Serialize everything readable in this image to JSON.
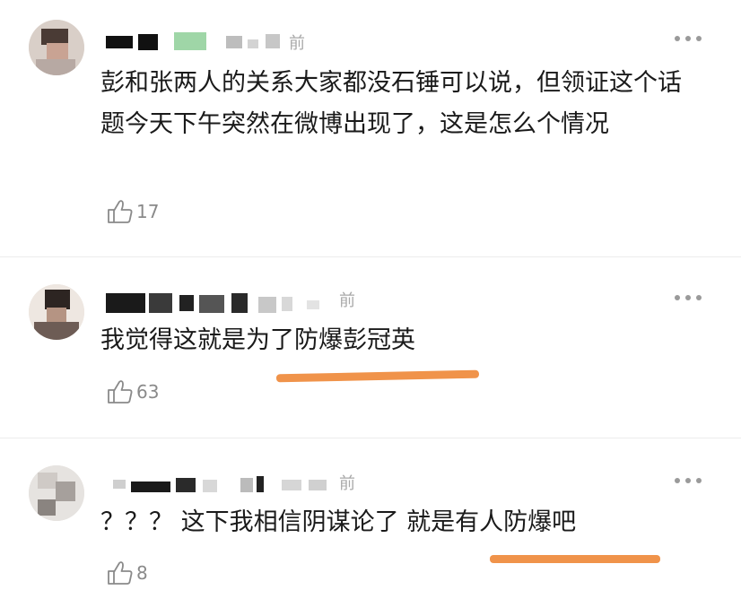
{
  "colors": {
    "accent_underline": "#f0934a",
    "text": "#1a1a1a",
    "muted": "#a8a8a8"
  },
  "comments": [
    {
      "time_suffix": "前",
      "text": "彭和张两人的关系大家都没石锤可以说，但领证这个话题今天下午突然在微博出现了，这是怎么个情况",
      "likes": "17",
      "more_icon": "more-dots-icon",
      "like_icon": "thumbs-up-icon"
    },
    {
      "time_suffix": "前",
      "text": "我觉得这就是为了防爆彭冠英",
      "likes": "63",
      "more_icon": "more-dots-icon",
      "like_icon": "thumbs-up-icon"
    },
    {
      "time_suffix": "前",
      "text": "？？？ 这下我相信阴谋论了 就是有人防爆吧",
      "likes": "8",
      "more_icon": "more-dots-icon",
      "like_icon": "thumbs-up-icon"
    }
  ]
}
